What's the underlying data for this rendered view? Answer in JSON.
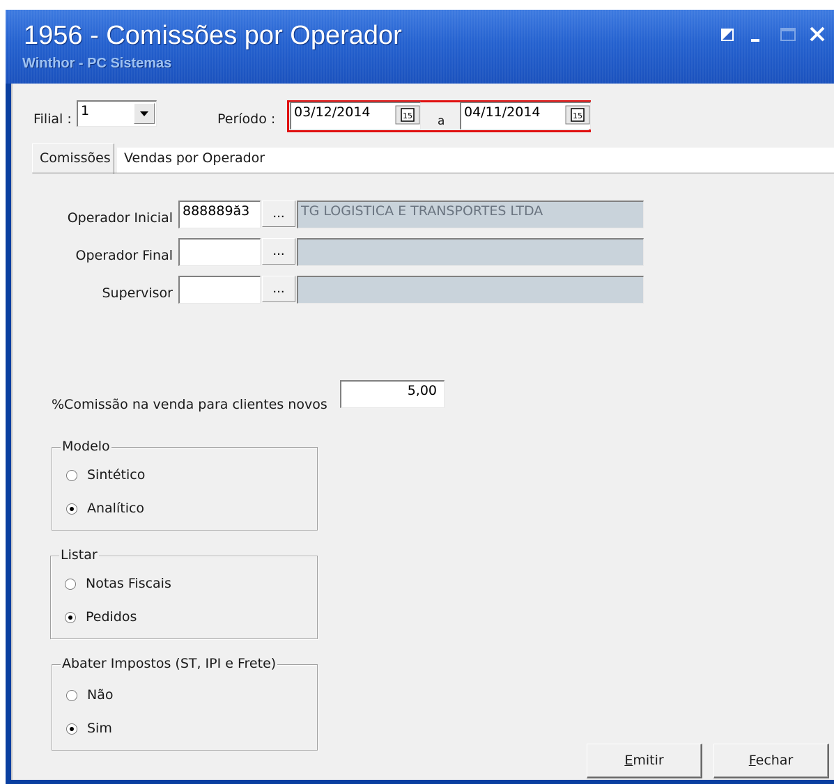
{
  "window": {
    "title": "1956 - Comissões por Operador",
    "subtitle": "Winthor - PC Sistemas",
    "controls": [
      "restore-icon",
      "minimize-icon",
      "maximize-icon",
      "close-icon"
    ]
  },
  "header": {
    "filial_label": "Filial :",
    "filial_value": "1",
    "periodo_label": "Período :",
    "date_start": "03/12/2014",
    "date_separator": "a",
    "date_end": "04/11/2014",
    "calendar_icon_text": "15"
  },
  "tabs": [
    {
      "label": "Comissões",
      "active": true
    },
    {
      "label": "Vendas por Operador",
      "active": false
    }
  ],
  "form": {
    "operador_inicial_label": "Operador Inicial",
    "operador_inicial_value": "888889ă3",
    "operador_inicial_name": "TG LOGISTICA E TRANSPORTES LTDA",
    "operador_final_label": "Operador Final",
    "operador_final_value": "",
    "operador_final_name": "",
    "supervisor_label": "Supervisor",
    "supervisor_value": "",
    "supervisor_name": "",
    "lookup_button_label": "...",
    "comissao_label": "%Comissão na venda para clientes novos",
    "comissao_value": "5,00"
  },
  "groups": {
    "modelo": {
      "title": "Modelo",
      "options": [
        "Sintético",
        "Analítico"
      ],
      "selected": "Analítico"
    },
    "listar": {
      "title": "Listar",
      "options": [
        "Notas Fiscais",
        "Pedidos"
      ],
      "selected": "Pedidos"
    },
    "abater": {
      "title": "Abater Impostos (ST, IPI e Frete)",
      "options": [
        "Não",
        "Sim"
      ],
      "selected": "Sim"
    }
  },
  "buttons": {
    "emitir_first": "E",
    "emitir_rest": "mitir",
    "fechar_first": "F",
    "fechar_rest": "echar"
  },
  "colors": {
    "titlebar": "#2461cf",
    "highlight": "#e01010",
    "client_bg": "#f0f0f0",
    "readonly_field": "#c9d3db"
  }
}
